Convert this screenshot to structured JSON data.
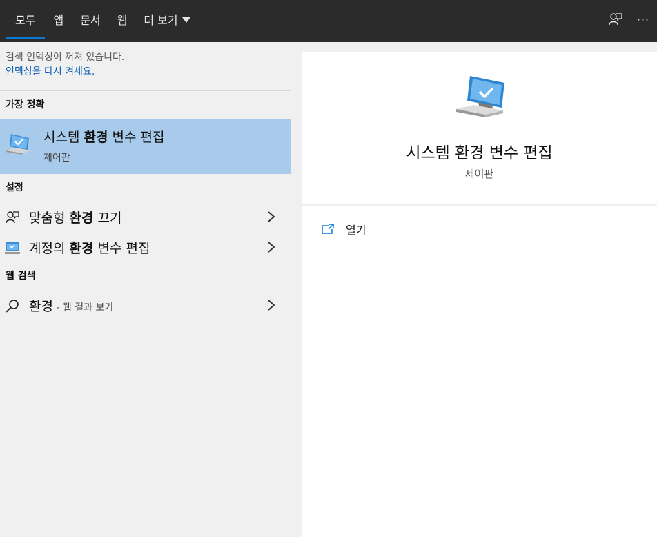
{
  "tabs": [
    {
      "label": "모두",
      "active": true
    },
    {
      "label": "앱"
    },
    {
      "label": "문서"
    },
    {
      "label": "웹"
    },
    {
      "label": "더 보기"
    }
  ],
  "top_icons": {
    "feedback": "feedback-person-icon",
    "more": "···"
  },
  "notice": {
    "line1": "검색 인덱싱이 꺼져 있습니다.",
    "link": "인덱싱을 다시 켜세요."
  },
  "best_match": {
    "header": "가장 정확",
    "title_pre": "시스템 ",
    "title_bold": "환경",
    "title_post": " 변수 편집",
    "subtitle": "제어판"
  },
  "settings": {
    "header": "설정",
    "items": [
      {
        "pre": "맞춤형 ",
        "bold": "환경",
        "post": " 끄기",
        "icon": "person-feedback-icon"
      },
      {
        "pre": "계정의 ",
        "bold": "환경",
        "post": " 변수 편집",
        "icon": "monitor-icon"
      }
    ]
  },
  "web": {
    "header": "웹 검색",
    "item": {
      "main": "환경",
      "suffix": " - 웹 결과 보기",
      "icon": "search-icon"
    }
  },
  "preview": {
    "title": "시스템 환경 변수 편집",
    "subtitle": "제어판",
    "action_label": "열기"
  },
  "colors": {
    "topbar": "#2b2b2b",
    "accent": "#0a78d7",
    "selected": "#a8cbeb",
    "link": "#0a5fb4"
  }
}
